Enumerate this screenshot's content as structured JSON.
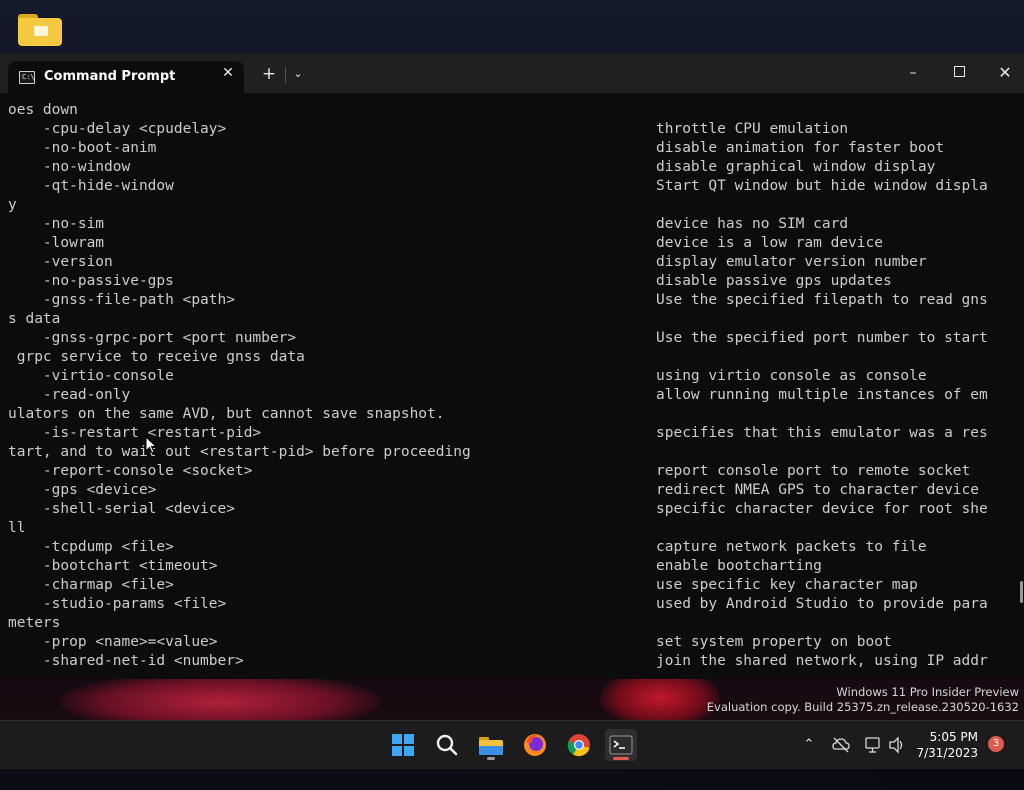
{
  "window": {
    "tab_title": "Command Prompt",
    "tab_icon_text": "C:\\"
  },
  "console_lines": [
    {
      "left": "oes down",
      "right": ""
    },
    {
      "left": "    -cpu-delay <cpudelay>",
      "right": "throttle CPU emulation"
    },
    {
      "left": "    -no-boot-anim",
      "right": "disable animation for faster boot"
    },
    {
      "left": "    -no-window",
      "right": "disable graphical window display"
    },
    {
      "left": "    -qt-hide-window",
      "right": "Start QT window but hide window displa"
    },
    {
      "left": "y",
      "right": ""
    },
    {
      "left": "    -no-sim",
      "right": "device has no SIM card"
    },
    {
      "left": "    -lowram",
      "right": "device is a low ram device"
    },
    {
      "left": "    -version",
      "right": "display emulator version number"
    },
    {
      "left": "    -no-passive-gps",
      "right": "disable passive gps updates"
    },
    {
      "left": "    -gnss-file-path <path>",
      "right": "Use the specified filepath to read gns"
    },
    {
      "left": "s data",
      "right": ""
    },
    {
      "left": "    -gnss-grpc-port <port number>",
      "right": "Use the specified port number to start"
    },
    {
      "left": " grpc service to receive gnss data",
      "right": ""
    },
    {
      "left": "    -virtio-console",
      "right": "using virtio console as console"
    },
    {
      "left": "    -read-only",
      "right": "allow running multiple instances of em"
    },
    {
      "left": "ulators on the same AVD, but cannot save snapshot.",
      "right": ""
    },
    {
      "left": "    -is-restart <restart-pid>",
      "right": "specifies that this emulator was a res"
    },
    {
      "left": "tart, and to wait out <restart-pid> before proceeding",
      "right": ""
    },
    {
      "left": "    -report-console <socket>",
      "right": "report console port to remote socket"
    },
    {
      "left": "    -gps <device>",
      "right": "redirect NMEA GPS to character device"
    },
    {
      "left": "    -shell-serial <device>",
      "right": "specific character device for root she"
    },
    {
      "left": "ll",
      "right": ""
    },
    {
      "left": "    -tcpdump <file>",
      "right": "capture network packets to file"
    },
    {
      "left": "    -bootchart <timeout>",
      "right": "enable bootcharting"
    },
    {
      "left": "    -charmap <file>",
      "right": "use specific key character map"
    },
    {
      "left": "    -studio-params <file>",
      "right": "used by Android Studio to provide para"
    },
    {
      "left": "meters",
      "right": ""
    },
    {
      "left": "    -prop <name>=<value>",
      "right": "set system property on boot"
    },
    {
      "left": "    -shared-net-id <number>",
      "right": "join the shared network, using IP addr"
    }
  ],
  "watermark": {
    "line1": "Windows 11 Pro Insider Preview",
    "line2": "Evaluation copy. Build 25375.zn_release.230520-1632"
  },
  "taskbar": {
    "apps": [
      "start-icon",
      "search-icon",
      "file-explorer-icon",
      "firefox-icon",
      "chrome-icon",
      "terminal-icon"
    ],
    "time": "5:05 PM",
    "date": "7/31/2023",
    "notification_count": "3"
  }
}
